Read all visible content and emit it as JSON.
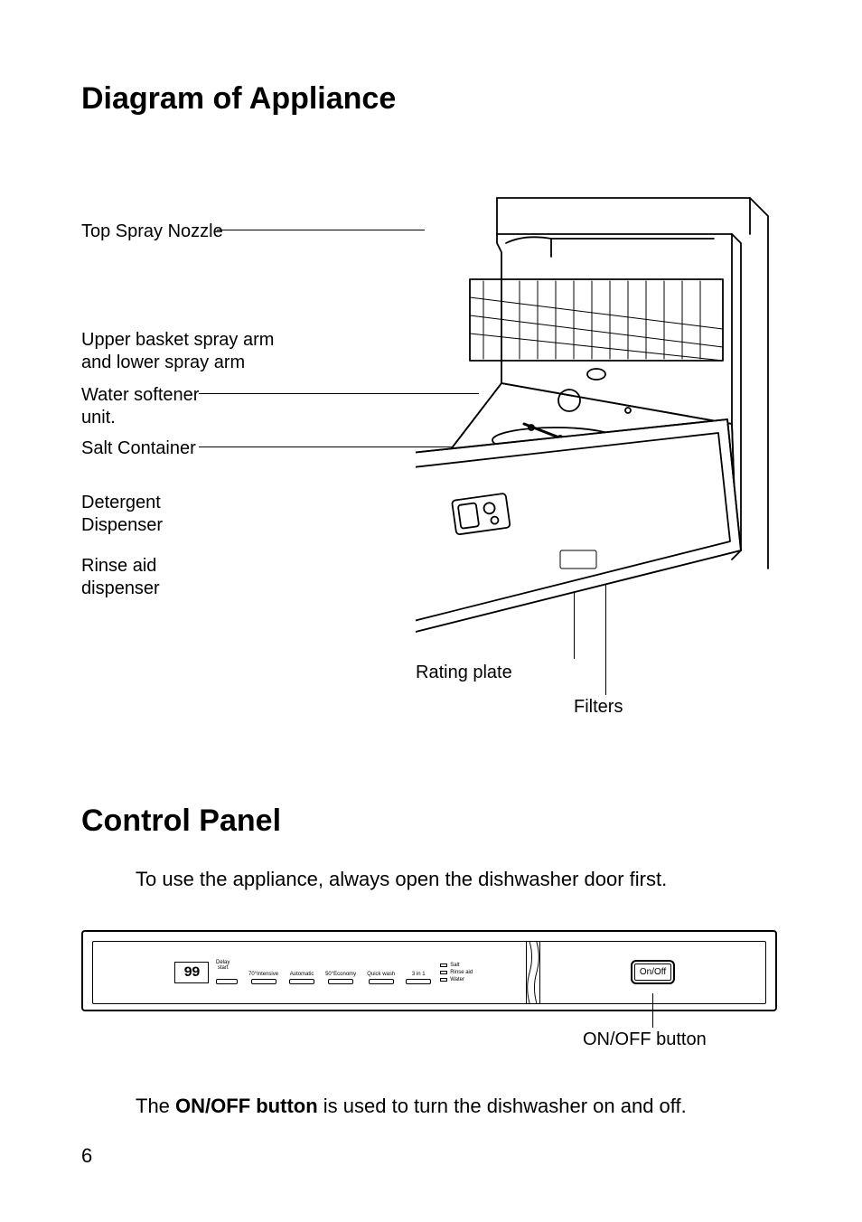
{
  "page_number": "6",
  "heading1": "Diagram of Appliance",
  "heading2": "Control Panel",
  "intro2": "To use the appliance, always open the dishwasher door first.",
  "onoff_sentence_pre": "The ",
  "onoff_sentence_bold": "ON/OFF button",
  "onoff_sentence_post": " is used to turn the dishwasher on and off.",
  "diagram_labels": {
    "top_spray": "Top Spray Nozzle",
    "upper_arm": "Upper basket spray arm\nand lower spray arm",
    "softener": "Water softener\nunit.",
    "salt": "Salt Container",
    "detergent": "Detergent\nDispenser",
    "rinse": "Rinse aid\ndispenser",
    "rating": "Rating plate",
    "filters": "Filters"
  },
  "panel": {
    "display_value": "99",
    "delay_label": "Delay\nstart",
    "programs": [
      "70°Intensive",
      "Automatic",
      "50°Economy",
      "Quick wash",
      "3 in 1"
    ],
    "indicators": [
      "Salt",
      "Rinse aid",
      "Water"
    ],
    "onoff_label": "On/Off",
    "onoff_caption": "ON/OFF button"
  }
}
